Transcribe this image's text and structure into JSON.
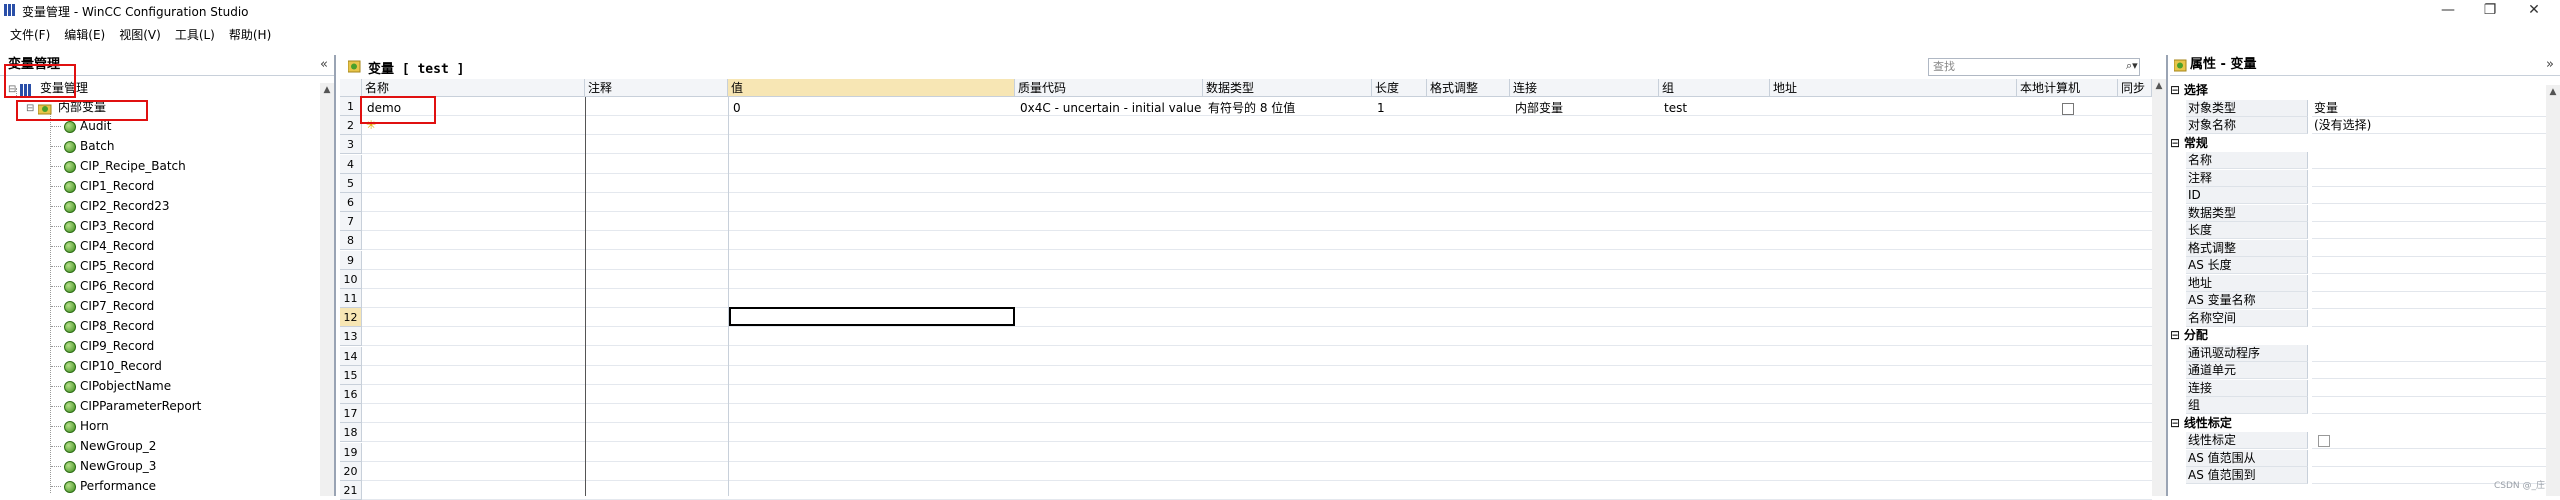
{
  "window": {
    "title": "变量管理 - WinCC Configuration Studio",
    "minimize": "—",
    "restore": "❐",
    "close": "✕"
  },
  "menu": [
    {
      "label": "文件(F)"
    },
    {
      "label": "编辑(E)"
    },
    {
      "label": "视图(V)"
    },
    {
      "label": "工具(L)"
    },
    {
      "label": "帮助(H)"
    }
  ],
  "tree": {
    "header": "变量管理",
    "root": "变量管理",
    "internal": "内部变量",
    "groups": [
      "Audit",
      "Batch",
      "CIP_Recipe_Batch",
      "CIP1_Record",
      "CIP2_Record23",
      "CIP3_Record",
      "CIP4_Record",
      "CIP5_Record",
      "CIP6_Record",
      "CIP7_Record",
      "CIP8_Record",
      "CIP9_Record",
      "CIP10_Record",
      "CIPobjectName",
      "CIPParameterReport",
      "Horn",
      "NewGroup_2",
      "NewGroup_3",
      "Performance"
    ]
  },
  "center": {
    "title": "变量 [ test ]",
    "search_placeholder": "查找",
    "columns": [
      "名称",
      "注释",
      "值",
      "质量代码",
      "数据类型",
      "长度",
      "格式调整",
      "连接",
      "组",
      "地址",
      "本地计算机",
      "同步"
    ],
    "row_numbers": [
      "1",
      "2",
      "3",
      "4",
      "5",
      "6",
      "7",
      "8",
      "9",
      "10",
      "11",
      "12",
      "13",
      "14",
      "15",
      "16",
      "17",
      "18",
      "19",
      "20",
      "21"
    ],
    "rows": [
      {
        "name": "demo",
        "comment": "",
        "value": "0",
        "quality": "0x4C - uncertain - initial value",
        "datatype": "有符号的 8 位值",
        "length": "1",
        "format": "",
        "connection": "内部变量",
        "group": "test",
        "address": ""
      }
    ]
  },
  "properties": {
    "header": "属性 - 变量",
    "sections": [
      {
        "title": "选择",
        "rows": [
          {
            "name": "对象类型",
            "value": "变量"
          },
          {
            "name": "对象名称",
            "value": "(没有选择)"
          }
        ]
      },
      {
        "title": "常规",
        "rows": [
          {
            "name": "名称",
            "value": ""
          },
          {
            "name": "注释",
            "value": ""
          },
          {
            "name": "ID",
            "value": ""
          },
          {
            "name": "数据类型",
            "value": ""
          },
          {
            "name": "长度",
            "value": ""
          },
          {
            "name": "格式调整",
            "value": ""
          },
          {
            "name": "AS 长度",
            "value": ""
          },
          {
            "name": "地址",
            "value": ""
          },
          {
            "name": "AS 变量名称",
            "value": ""
          },
          {
            "name": "名称空间",
            "value": ""
          }
        ]
      },
      {
        "title": "分配",
        "rows": [
          {
            "name": "通讯驱动程序",
            "value": ""
          },
          {
            "name": "通道单元",
            "value": ""
          },
          {
            "name": "连接",
            "value": ""
          },
          {
            "name": "组",
            "value": ""
          }
        ]
      },
      {
        "title": "线性标定",
        "rows": [
          {
            "name": "线性标定",
            "value": ""
          },
          {
            "name": "AS 值范围从",
            "value": ""
          },
          {
            "name": "AS 值范围到",
            "value": ""
          }
        ]
      }
    ]
  },
  "watermark": "CSDN @_庄"
}
